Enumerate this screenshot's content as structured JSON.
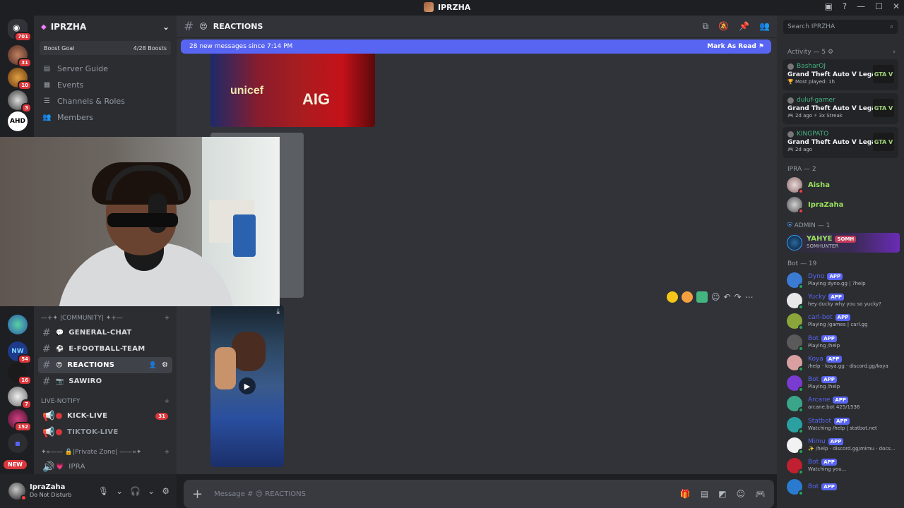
{
  "window": {
    "title": "IPRZHA"
  },
  "rail": {
    "home_badge": "701",
    "badges": [
      "31",
      "10",
      "3",
      "54",
      "16",
      "7",
      "152"
    ],
    "ahd_label": "AHD",
    "new_label": "NEW"
  },
  "server": {
    "name": "IPRZHA",
    "boost_label": "Boost Goal",
    "boost_count": "4/28 Boosts",
    "nav": [
      "Server Guide",
      "Events",
      "Channels & Roles",
      "Members"
    ]
  },
  "categories": {
    "community": "—+✦ |COMMUNITY| ✦+—",
    "live_notify": "LIVE-NOTIFY",
    "private_zone": "✦»—— 🔒|Private Zone| ——«✦"
  },
  "channels": {
    "general_chat": "GENERAL-CHAT",
    "efootball": "E-FOOTBALL-TEAM",
    "reactions": "REACTIONS",
    "sawiro": "SAWIRO",
    "kick_live": "KICK-LIVE",
    "kick_live_badge": "31",
    "tiktok_live": "TIKTOK-LIVE",
    "ipra": "IPRA"
  },
  "user": {
    "name": "IpraZaha",
    "status": "Do Not Disturb"
  },
  "chat": {
    "channel": "REACTIONS",
    "new_messages": "28 new messages since 7:14 PM",
    "mark_read": "Mark As Read",
    "composer_prefix": "Message #",
    "composer_channel": "REACTIONS",
    "jersey_left": "unicef",
    "jersey_right": "AIG"
  },
  "members": {
    "search_placeholder": "Search IPRZHA",
    "activity_header": "Activity — 5",
    "activities": [
      {
        "user": "BasharOJ",
        "game": "Grand Theft Auto V Legacy",
        "meta": "🏆 Most played: 1h"
      },
      {
        "user": "duluf-gamer",
        "game": "Grand Theft Auto V Legacy",
        "meta": "🎮 2d ago   ⚡ 3x Streak"
      },
      {
        "user": "KINGPATO",
        "game": "Grand Theft Auto V Legacy",
        "meta": "🎮 2d ago"
      }
    ],
    "game_icon": "GTA V",
    "ipra_header": "IPRA — 2",
    "ipra_members": [
      "Aisha",
      "IpraZaha"
    ],
    "admin_header": "ADMIN — 1",
    "admin_name": "YAHYE",
    "admin_tag": "SOMH",
    "admin_sub": "SOMHUNTER",
    "bot_header": "Bot — 19",
    "app_label": "APP",
    "bots": [
      {
        "name": "Dyno",
        "status": "Playing dyno.gg | ?help",
        "color": "#3b7bd4"
      },
      {
        "name": "Yucky",
        "status": "hey ducky why you so yucky?",
        "color": "#e8e8e8"
      },
      {
        "name": "carl-bot",
        "status": "Playing /games | carl.gg",
        "color": "#8aa63a"
      },
      {
        "name": "Bot",
        "status": "Playing /help",
        "color": "#5a5a5a"
      },
      {
        "name": "Koya",
        "status": "/help · koya.gg · discord.gg/koya",
        "color": "#d8a0a0"
      },
      {
        "name": "Bot",
        "status": "Playing /help",
        "color": "#7a3bd0"
      },
      {
        "name": "Arcane",
        "status": "arcane.bot 425/1536",
        "color": "#3ba58a"
      },
      {
        "name": "Statbot",
        "status": "Watching /help | statbot.net",
        "color": "#2aa0a0"
      },
      {
        "name": "Mimu",
        "status": "✨ /help · discord.gg/mimu · docs...",
        "color": "#f2f2f2"
      },
      {
        "name": "Bot",
        "status": "Watching you...",
        "color": "#c02030"
      },
      {
        "name": "Bot",
        "status": "",
        "color": "#2a7ad0"
      }
    ]
  }
}
